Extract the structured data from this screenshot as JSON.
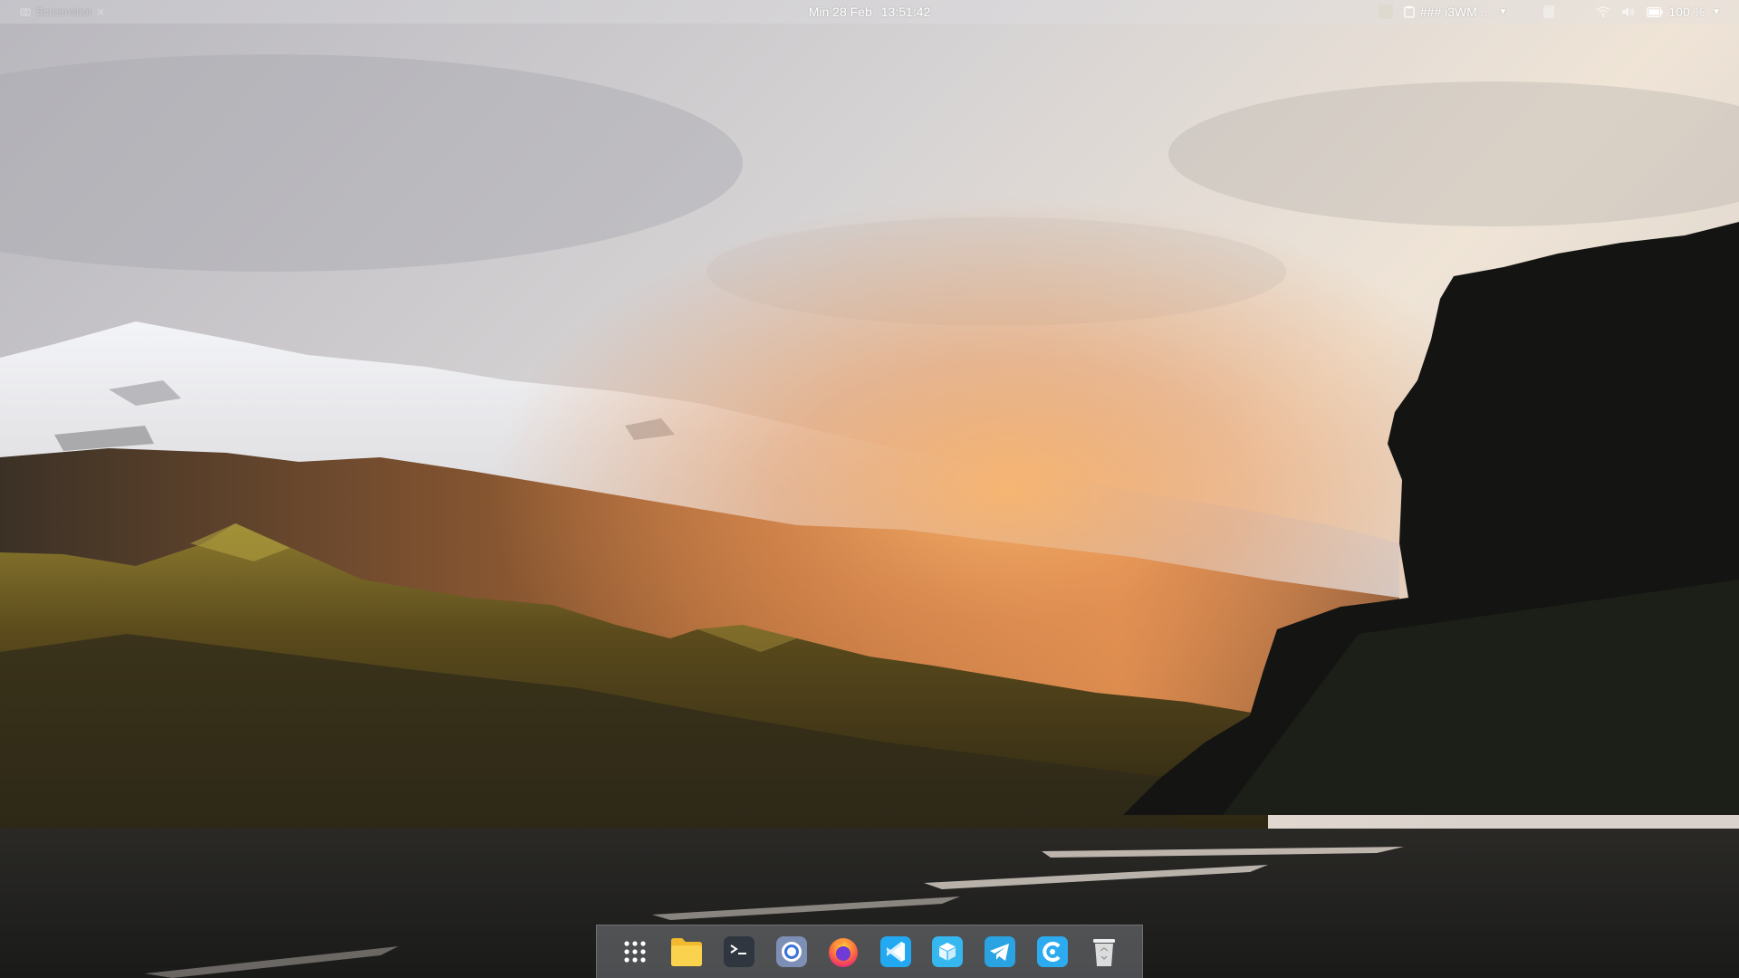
{
  "top_panel": {
    "left_label": "Screenshot",
    "clock": {
      "date": "Min 28 Feb",
      "time": "13:51:42"
    },
    "clipboard_label": "### i3WM ...",
    "battery_percent": "100 %"
  },
  "dock": {
    "items": [
      {
        "name": "App Launcher",
        "icon": "app-grid-icon"
      },
      {
        "name": "Files",
        "icon": "folder-icon",
        "color": "#f6c644"
      },
      {
        "name": "Terminal",
        "icon": "terminal-icon",
        "color": "#2f3640"
      },
      {
        "name": "Chromium",
        "icon": "chromium-icon",
        "color": "#4a86e8"
      },
      {
        "name": "Firefox",
        "icon": "firefox-icon",
        "color": "#ff7139"
      },
      {
        "name": "Visual Studio Code",
        "icon": "vscode-icon",
        "color": "#23a9f2"
      },
      {
        "name": "Software Center",
        "icon": "package-icon",
        "color": "#35b7f0"
      },
      {
        "name": "Telegram",
        "icon": "telegram-icon",
        "color": "#2aa3e2"
      },
      {
        "name": "CodeBlocks",
        "icon": "c-app-icon",
        "color": "#2dabf0"
      },
      {
        "name": "Trash",
        "icon": "trash-icon",
        "color": "#d9d9d9"
      }
    ]
  },
  "wallpaper": {
    "description_colors": {
      "sky_top": "#c9c8cd",
      "sky_glow": "#f1d9b8",
      "sun": "#f0a060",
      "ground": "#1e1e1c"
    }
  }
}
